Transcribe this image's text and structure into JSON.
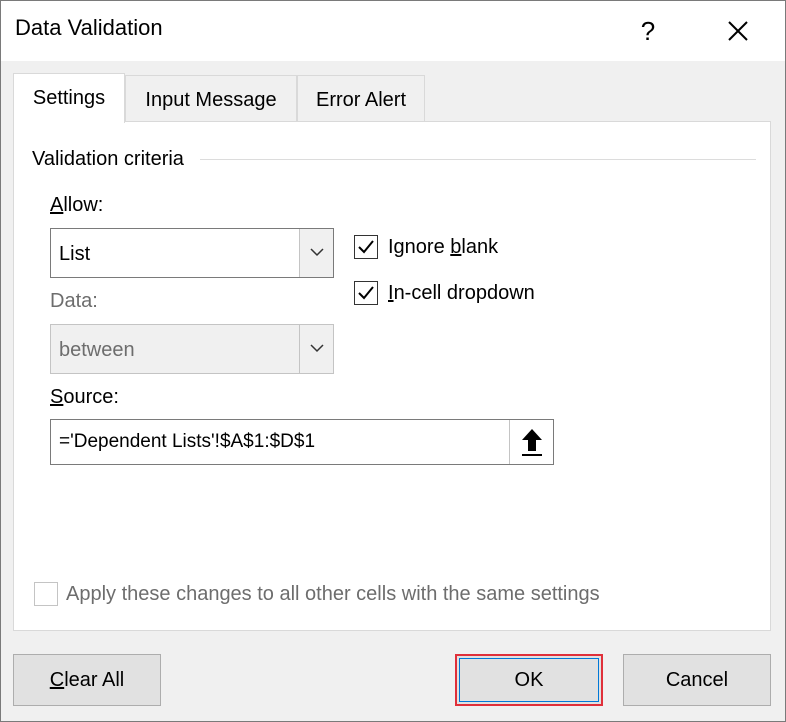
{
  "window": {
    "title": "Data Validation",
    "help_label": "?",
    "close_icon": "close-icon"
  },
  "tabs": [
    {
      "label": "Settings",
      "active": true
    },
    {
      "label": "Input Message",
      "active": false
    },
    {
      "label": "Error Alert",
      "active": false
    }
  ],
  "settings": {
    "group_label": "Validation criteria",
    "allow": {
      "label_first": "A",
      "label_rest": "llow:",
      "value": "List"
    },
    "data": {
      "label": "Data:",
      "value": "between",
      "disabled": true
    },
    "ignore_blank": {
      "label_pre": "Ignore ",
      "label_u": "b",
      "label_post": "lank",
      "checked": true
    },
    "in_cell_dropdown": {
      "label_u": "I",
      "label_post": "n-cell dropdown",
      "checked": true
    },
    "source": {
      "label_first": "S",
      "label_rest": "ource:",
      "value": "='Dependent Lists'!$A$1:$D$1",
      "collapse_icon": "arrow-up-icon"
    },
    "apply_all": {
      "label": "Apply these changes to all other cells with the same settings",
      "checked": false,
      "disabled": true
    }
  },
  "buttons": {
    "clear_all_u": "C",
    "clear_all_rest": "lear All",
    "ok": "OK",
    "cancel": "Cancel"
  },
  "colors": {
    "dialog_bg": "#f0f0f0",
    "panel_bg": "#ffffff",
    "default_button_border": "#e0303a"
  }
}
